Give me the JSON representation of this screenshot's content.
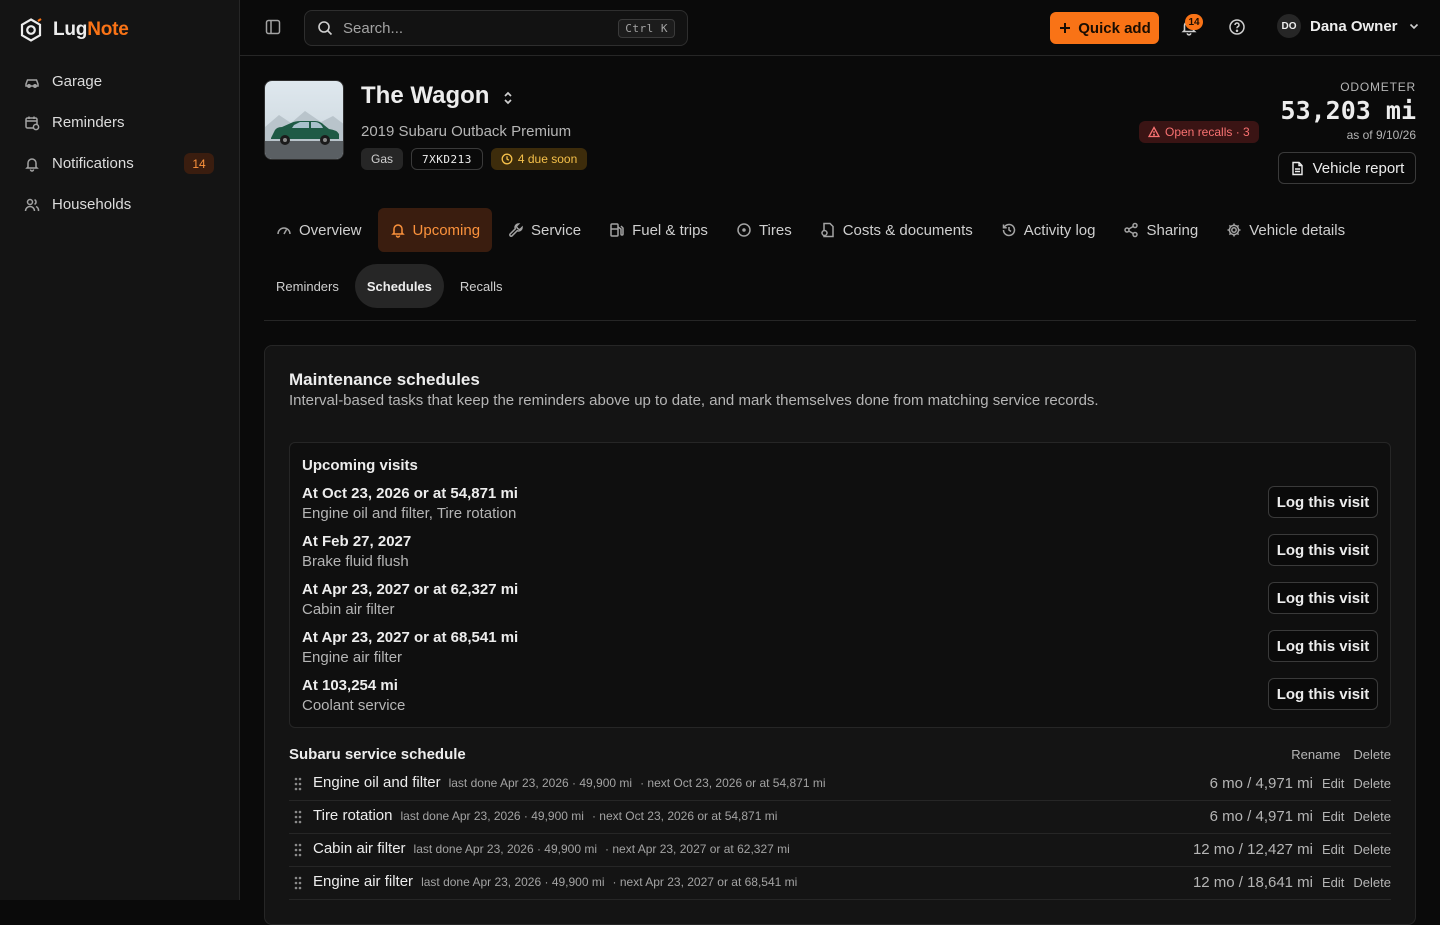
{
  "brand": {
    "name_a": "Lug",
    "name_b": "Note"
  },
  "sidebar": {
    "items": [
      {
        "label": "Garage"
      },
      {
        "label": "Reminders"
      },
      {
        "label": "Notifications",
        "badge": "14"
      },
      {
        "label": "Households"
      }
    ]
  },
  "topbar": {
    "search_placeholder": "Search...",
    "search_shortcut": "Ctrl K",
    "quick_add": "Quick add",
    "notifications_count": "14",
    "user_initials": "DO",
    "user_name": "Dana Owner"
  },
  "vehicle": {
    "name": "The Wagon",
    "subtitle": "2019 Subaru Outback Premium",
    "fuel": "Gas",
    "plate": "7XKD213",
    "due_soon": "4 due soon",
    "recalls": "Open recalls · 3",
    "odometer_label": "ODOMETER",
    "odometer_value": "53,203 mi",
    "odometer_date": "as of 9/10/26",
    "report_button": "Vehicle report"
  },
  "tabs": [
    {
      "label": "Overview",
      "icon": "gauge-icon"
    },
    {
      "label": "Upcoming",
      "icon": "bell-icon",
      "active": true
    },
    {
      "label": "Service",
      "icon": "wrench-icon"
    },
    {
      "label": "Fuel & trips",
      "icon": "fuel-icon"
    },
    {
      "label": "Tires",
      "icon": "circle-icon"
    },
    {
      "label": "Costs & documents",
      "icon": "document-icon"
    },
    {
      "label": "Activity log",
      "icon": "history-icon"
    },
    {
      "label": "Sharing",
      "icon": "share-icon"
    },
    {
      "label": "Vehicle details",
      "icon": "gear-icon"
    }
  ],
  "subtabs": [
    {
      "label": "Reminders"
    },
    {
      "label": "Schedules",
      "active": true
    },
    {
      "label": "Recalls"
    }
  ],
  "schedules_card": {
    "title": "Maintenance schedules",
    "description": "Interval-based tasks that keep the reminders above up to date, and mark themselves done from matching service records.",
    "upcoming_title": "Upcoming visits",
    "log_button": "Log this visit",
    "visits": [
      {
        "when": "At Oct 23, 2026 or at 54,871 mi",
        "tasks": "Engine oil and filter, Tire rotation"
      },
      {
        "when": "At Feb 27, 2027",
        "tasks": "Brake fluid flush"
      },
      {
        "when": "At Apr 23, 2027 or at 62,327 mi",
        "tasks": "Cabin air filter"
      },
      {
        "when": "At Apr 23, 2027 or at 68,541 mi",
        "tasks": "Engine air filter"
      },
      {
        "when": "At 103,254 mi",
        "tasks": "Coolant service"
      }
    ],
    "schedule_name": "Subaru service schedule",
    "rename_label": "Rename",
    "delete_label": "Delete",
    "edit_label": "Edit",
    "tasks": [
      {
        "name": "Engine oil and filter",
        "last": "last done Apr 23, 2026 · 49,900 mi",
        "next": "· next Oct 23, 2026 or at 54,871 mi",
        "interval": "6 mo / 4,971 mi"
      },
      {
        "name": "Tire rotation",
        "last": "last done Apr 23, 2026 · 49,900 mi",
        "next": "· next Oct 23, 2026 or at 54,871 mi",
        "interval": "6 mo / 4,971 mi"
      },
      {
        "name": "Cabin air filter",
        "last": "last done Apr 23, 2026 · 49,900 mi",
        "next": "· next Apr 23, 2027 or at 62,327 mi",
        "interval": "12 mo / 12,427 mi"
      },
      {
        "name": "Engine air filter",
        "last": "last done Apr 23, 2026 · 49,900 mi",
        "next": "· next Apr 23, 2027 or at 68,541 mi",
        "interval": "12 mo / 18,641 mi"
      }
    ]
  },
  "colors": {
    "accent": "#f97316",
    "background": "#0a0a0a",
    "surface": "#141414",
    "danger": "#f87171",
    "warning": "#f5c04a"
  }
}
